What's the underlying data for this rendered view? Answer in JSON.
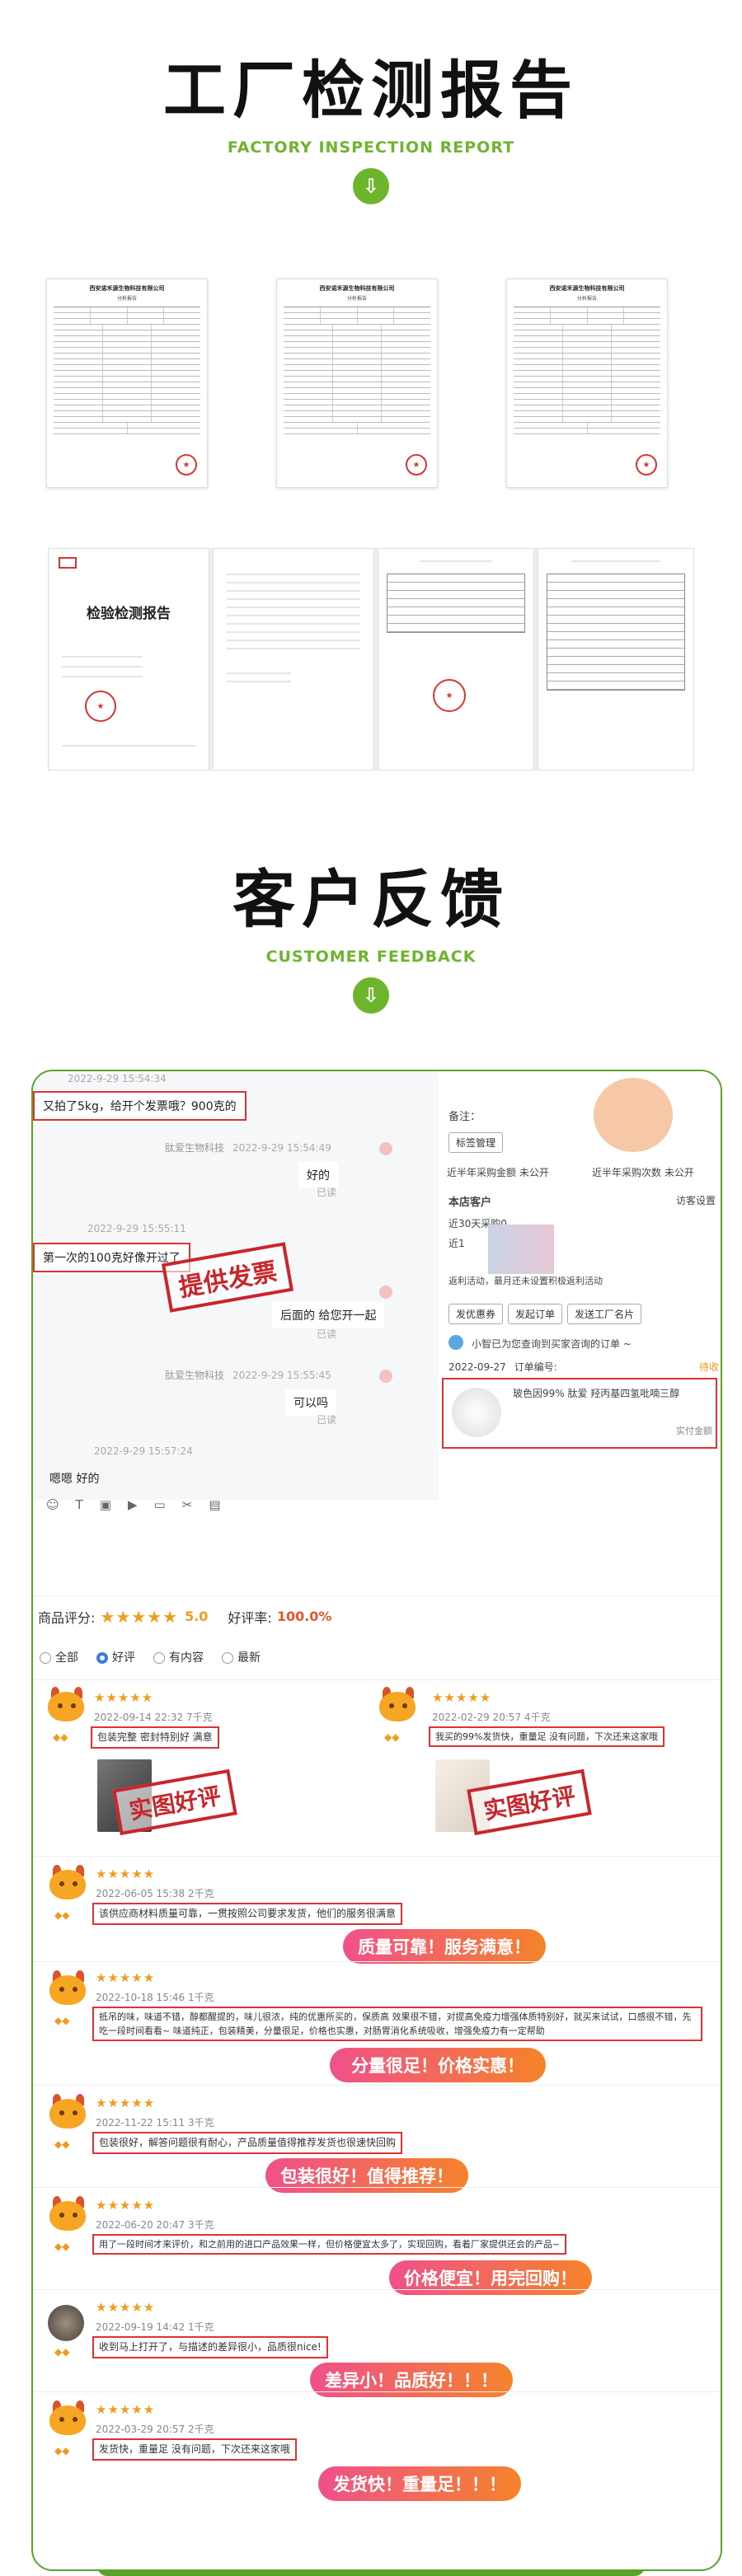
{
  "factory": {
    "title": "工厂检测报告",
    "subtitle": "FACTORY INSPECTION REPORT",
    "report_company": "西安诺禾源生物科技有限公司",
    "report_heading": "分析报告",
    "certificate_title": "检验检测报告"
  },
  "feedback": {
    "title": "客户反馈",
    "subtitle": "CUSTOMER FEEDBACK"
  },
  "chat": {
    "messages": [
      {
        "text": "又拍了5kg，给开个发票哦？900克的",
        "boxed": true
      },
      {
        "sender": "肽爱生物科技",
        "time": "2022-9-29 15:54:49",
        "text": "好的",
        "read": "已读"
      },
      {
        "time": "2022-9-29 15:55:11",
        "text": "第一次的100克好像开过了",
        "boxed": true
      },
      {
        "text": "后面的 给您开一起",
        "read": "已读"
      },
      {
        "sender": "肽爱生物科技",
        "time": "2022-9-29 15:55:45",
        "text": "可以吗",
        "read": "已读"
      },
      {
        "time": "2022-9-29 15:57:24",
        "text": "嗯嗯 好的"
      }
    ],
    "top_time": "2022-9-29 15:54:34",
    "stamp_invoice": "提供发票"
  },
  "side_panel": {
    "remark_label": "备注：",
    "tag_button": "标签管理",
    "stat1": "近半年采购金额 未公开",
    "stat2": "近半年采购次数 未公开",
    "customer_label": "本店客户",
    "fan_label": "访客设置",
    "days_label": "近30天采购0",
    "recent_label": "近1",
    "reverse_text": "返利活动，最月还未设置积极返利活动",
    "buttons": [
      "发优惠券",
      "发起订单",
      "发送工厂名片"
    ],
    "bot_text": "小智已为您查询到买家咨询的订单 ~",
    "order_date": "2022-09-27",
    "order_label": "订单编号:",
    "order_status": "待收",
    "product_text": "玻色因99% 肽爱 羟丙基四氢吡喃三醇",
    "paid_label": "实付金额"
  },
  "rating": {
    "label": "商品评分:",
    "score": "5.0",
    "rate_label": "好评率:",
    "rate": "100.0%"
  },
  "filters": [
    "全部",
    "好评",
    "有内容",
    "最新"
  ],
  "reviews": [
    {
      "stars": "★★★★★",
      "meta": "2022-09-14 22:32   7千克",
      "text": "包装完整 密封特别好 满意",
      "stamp": "实图好评"
    },
    {
      "stars": "★★★★★",
      "meta": "2022-02-29 20:57   4千克",
      "text": "我买的99%发货快，重量足 没有问题，下次还来这家哦",
      "stamp": "实图好评"
    },
    {
      "stars": "★★★★★",
      "meta": "2022-06-05 15:38   2千克",
      "text": "该供应商材料质量可靠，一贯按照公司要求发货，他们的服务很满意",
      "pill": "质量可靠！服务满意！"
    },
    {
      "stars": "★★★★★",
      "meta": "2022-10-18 15:46   1千克",
      "text": "抵吊的味，味道不错，醇都醒提的，味儿很浓，纯的优惠所买的，保质高 效果很不错，对提高免疫力增强体质特别好，就买来试试，口感很不错，先吃一段时间看看~ 味道纯正，包装精美，分量很足，价格也实惠，对肠胃消化系统吸收，增强免疫力有一定帮助",
      "pill": "分量很足！价格实惠！"
    },
    {
      "stars": "★★★★★",
      "meta": "2022-11-22 15:11   3千克",
      "text": "包装很好，解答问题很有耐心，产品质量值得推荐发货也很速快回购",
      "pill": "包装很好！值得推荐！"
    },
    {
      "stars": "★★★★★",
      "meta": "2022-06-20 20:47   3千克",
      "text": "用了一段时间才来评价，和之前用的进口产品效果一样，但价格便宜太多了，实现回购，看着厂家提供还会的产品~",
      "pill": "价格便宜！用完回购！"
    },
    {
      "stars": "★★★★★",
      "meta": "2022-09-19 14:42   1千克",
      "text": "收到马上打开了，与描述的差异很小，品质很nice!",
      "pill": "差异小！品质好！！！"
    },
    {
      "stars": "★★★★★",
      "meta": "2022-03-29 20:57   2千克",
      "text": "发货快，重量足 没有问题，下次还来这家哦",
      "pill": "发货快！重量足！！！"
    }
  ]
}
